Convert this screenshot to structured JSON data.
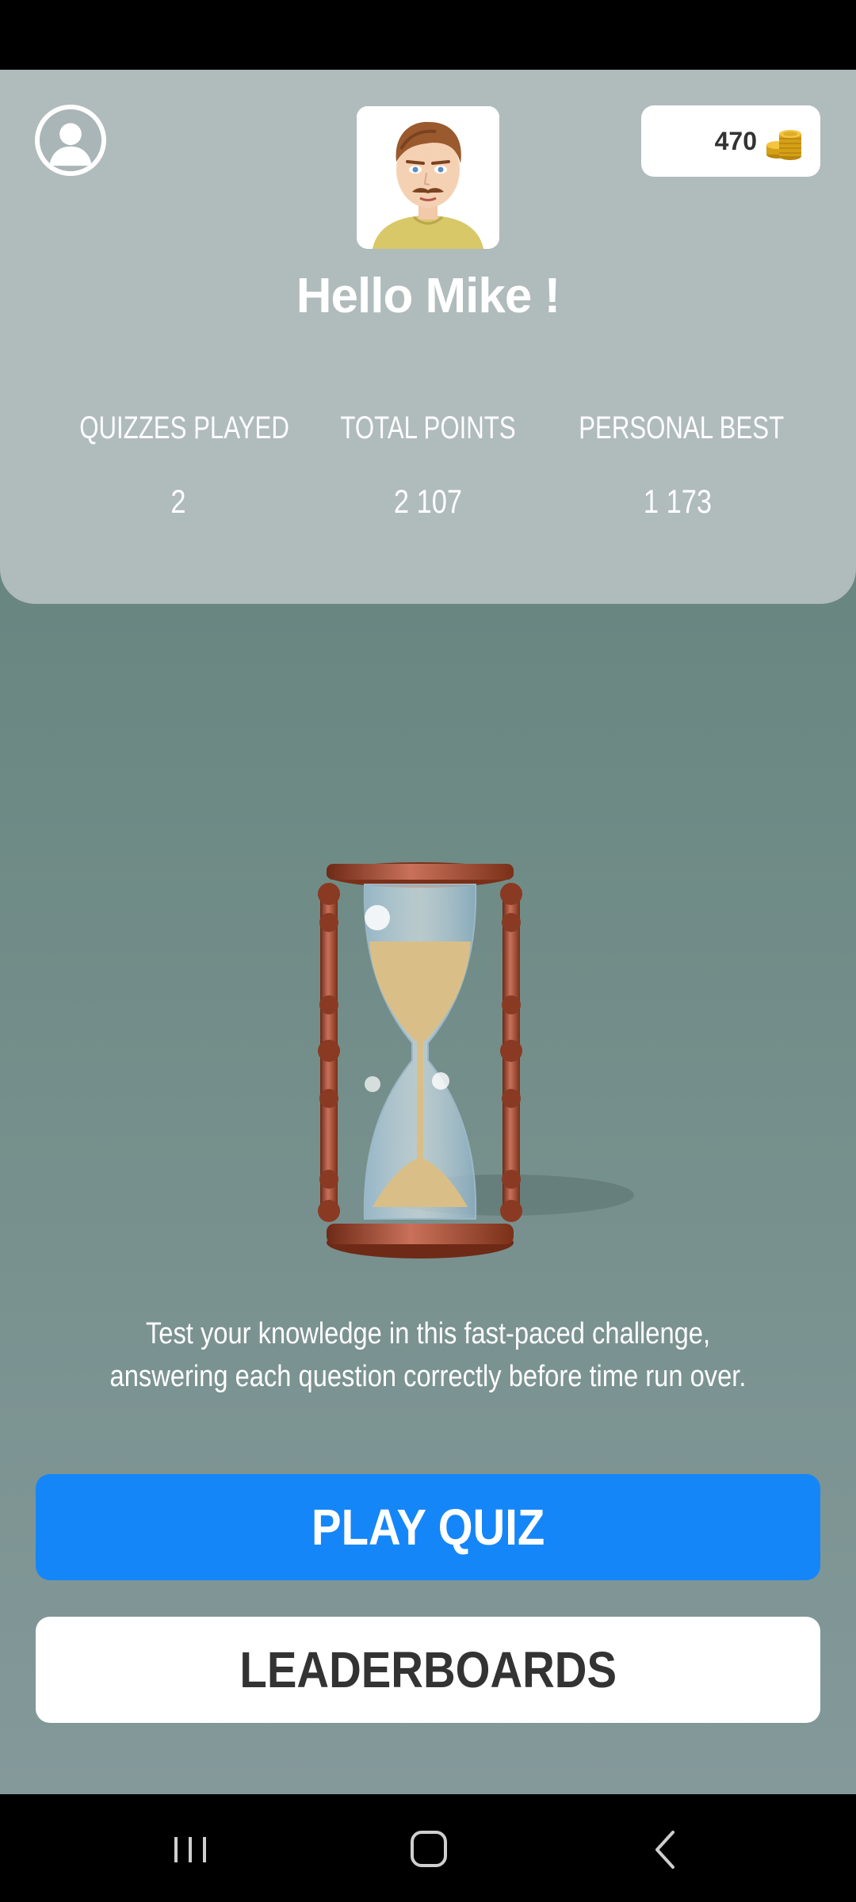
{
  "header": {
    "coins": "470",
    "greeting": "Hello Mike !",
    "stats": [
      {
        "label": "QUIZZES PLAYED",
        "value": "2"
      },
      {
        "label": "TOTAL POINTS",
        "value": "2 107"
      },
      {
        "label": "PERSONAL BEST",
        "value": "1 173"
      }
    ]
  },
  "main": {
    "description": "Test your knowledge in this fast-paced challenge, answering each question correctly before time run over.",
    "play_label": "PLAY QUIZ",
    "leaderboards_label": "LEADERBOARDS"
  },
  "icons": {
    "profile": "user-silhouette-icon",
    "coins": "gold-coins-icon",
    "hero": "hourglass-icon",
    "nav_recent": "recent-apps-icon",
    "nav_home": "home-icon",
    "nav_back": "back-icon"
  },
  "colors": {
    "primary_button": "#1586f7",
    "header_card": "#b0bbbc",
    "background_top": "#5d7b76",
    "background_bottom": "#84999a"
  }
}
